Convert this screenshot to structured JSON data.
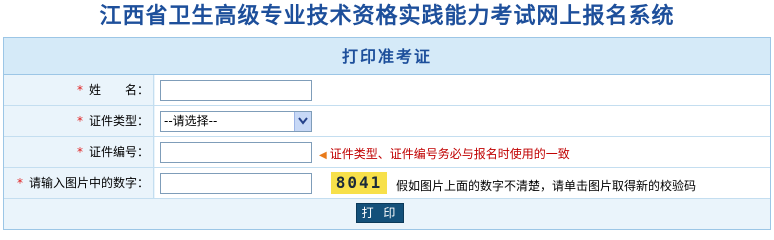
{
  "system_title": "江西省卫生高级专业技术资格实践能力考试网上报名系统",
  "form": {
    "title": "打印准考证",
    "required_mark": "*",
    "name": {
      "label": "姓　　名：",
      "value": ""
    },
    "id_type": {
      "label": "证件类型：",
      "selected": "--请选择--"
    },
    "id_number": {
      "label": "证件编号：",
      "value": "",
      "hint": "证件类型、证件编号务必与报名时使用的一致"
    },
    "captcha": {
      "label": "请输入图片中的数字：",
      "value": "",
      "image_text": "8041",
      "note": "假如图片上面的数字不清楚，请单击图片取得新的校验码"
    },
    "print_button": "打 印"
  },
  "colors": {
    "title": "#1d4f9b",
    "required": "#e02020",
    "hint": "#c00000",
    "captcha_bg": "#f7e04a",
    "button_bg": "#13507a"
  },
  "icons": {
    "hint_marker": "triangle-left-icon",
    "select_arrow": "chevron-down-icon"
  }
}
